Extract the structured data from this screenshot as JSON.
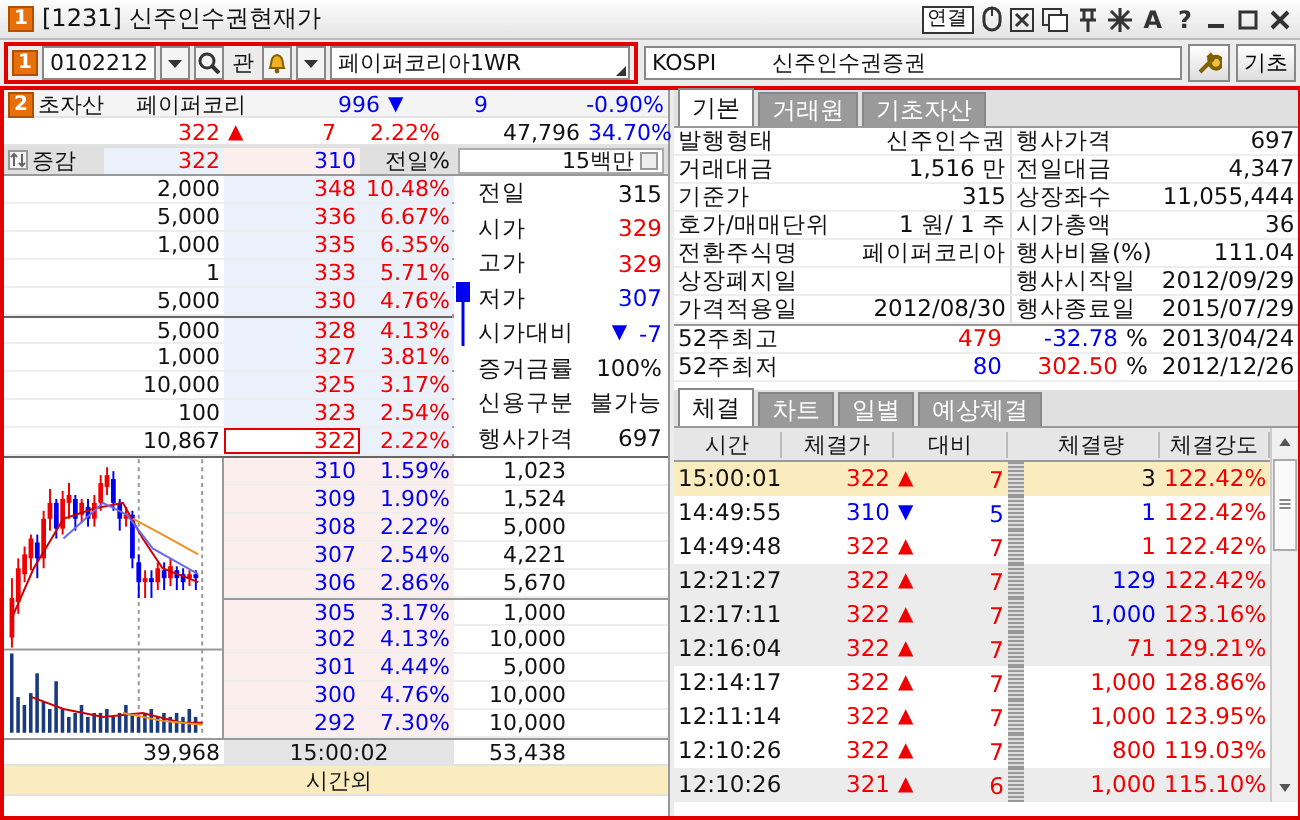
{
  "window": {
    "icon_label": "1",
    "title": "[1231] 신주인수권현재가",
    "link_button": "연결",
    "glyph_buttons": [
      "A",
      "?"
    ]
  },
  "toolbar": {
    "badge": "1",
    "code": "0102212",
    "mode": "관",
    "name": "페이퍼코리아1WR",
    "market": "KOSPI",
    "security_name": "신주인수권증권",
    "button": "기초"
  },
  "main": {
    "badge": "2"
  },
  "underlying": {
    "label": "초자산",
    "name": "페이퍼코리",
    "price": "996",
    "arrow": "▼",
    "color": "#0000f0",
    "change": "9",
    "rate": "-0.90%"
  },
  "current": {
    "price": "322",
    "arrow": "▲",
    "color": "#f00000",
    "change": "7",
    "rate": "2.22%",
    "volume": "47,796",
    "ratio": "34.70%"
  },
  "orderbook_header": {
    "label": "증감",
    "high": "322",
    "low": "310",
    "column": "전일%",
    "amount": "15백만"
  },
  "asks": [
    {
      "qty": "2,000",
      "price": "348",
      "pct": "10.48%",
      "current": false
    },
    {
      "qty": "5,000",
      "price": "336",
      "pct": "6.67%",
      "current": false
    },
    {
      "qty": "1,000",
      "price": "335",
      "pct": "6.35%",
      "current": false
    },
    {
      "qty": "1",
      "price": "333",
      "pct": "5.71%",
      "current": false
    },
    {
      "qty": "5,000",
      "price": "330",
      "pct": "4.76%",
      "current": false
    },
    {
      "qty": "5,000",
      "price": "328",
      "pct": "4.13%",
      "current": false
    },
    {
      "qty": "1,000",
      "price": "327",
      "pct": "3.81%",
      "current": false
    },
    {
      "qty": "10,000",
      "price": "325",
      "pct": "3.17%",
      "current": false
    },
    {
      "qty": "100",
      "price": "323",
      "pct": "2.54%",
      "current": false
    },
    {
      "qty": "10,867",
      "price": "322",
      "pct": "2.22%",
      "current": true
    }
  ],
  "info": [
    {
      "label": "전일",
      "value": "315",
      "color": "#111111"
    },
    {
      "label": "시가",
      "value": "329",
      "color": "#f00000"
    },
    {
      "label": "고가",
      "value": "329",
      "color": "#f00000"
    },
    {
      "label": "저가",
      "value": "307",
      "color": "#0000f0"
    },
    {
      "label": "시가대비",
      "value": "-7",
      "color": "#0000f0",
      "arrow": "▼"
    },
    {
      "label": "증거금률",
      "value": "100%",
      "color": "#111111"
    },
    {
      "label": "신용구분",
      "value": "불가능",
      "color": "#111111"
    },
    {
      "label": "행사가격",
      "value": "697",
      "color": "#111111"
    }
  ],
  "bids": [
    {
      "price": "310",
      "pct": "1.59%",
      "qty": "1,023"
    },
    {
      "price": "309",
      "pct": "1.90%",
      "qty": "1,524"
    },
    {
      "price": "308",
      "pct": "2.22%",
      "qty": "5,000"
    },
    {
      "price": "307",
      "pct": "2.54%",
      "qty": "4,221"
    },
    {
      "price": "306",
      "pct": "2.86%",
      "qty": "5,670"
    },
    {
      "price": "305",
      "pct": "3.17%",
      "qty": "1,000"
    },
    {
      "price": "302",
      "pct": "4.13%",
      "qty": "10,000"
    },
    {
      "price": "301",
      "pct": "4.44%",
      "qty": "5,000"
    },
    {
      "price": "300",
      "pct": "4.76%",
      "qty": "10,000"
    },
    {
      "price": "292",
      "pct": "7.30%",
      "qty": "10,000"
    }
  ],
  "totals": {
    "ask_total": "39,968",
    "time": "15:00:02",
    "bid_total": "53,438"
  },
  "session": "시간외",
  "tabs": [
    {
      "label": "기본",
      "selected": true
    },
    {
      "label": "거래원",
      "selected": false
    },
    {
      "label": "기초자산",
      "selected": false
    }
  ],
  "basic_info": [
    {
      "label": "발행형태",
      "value": "신주인수권",
      "label_2": "행사가격",
      "value_2": "697"
    },
    {
      "label": "거래대금",
      "value": "1,516 만",
      "label_2": "전일대금",
      "value_2": "4,347"
    },
    {
      "label": "기준가",
      "value": "315",
      "label_2": "상장좌수",
      "value_2": "11,055,444"
    },
    {
      "label": "호가/매매단위",
      "value": "1 원/ 1 주",
      "label_2": "시가총액",
      "value_2": "36"
    },
    {
      "label": "전환주식명",
      "value": "페이퍼코리아",
      "label_2": "행사비율(%)",
      "value_2": "111.04"
    },
    {
      "label": "상장폐지일",
      "label_2": "행사시작일",
      "value_2": "2012/09/29"
    },
    {
      "label": "가격적용일",
      "value": "2012/08/30",
      "label_2": "행사종료일",
      "value_2": "2015/07/29"
    }
  ],
  "week52": [
    {
      "label": "52주최고",
      "price": {
        "value": "479",
        "color": "#f00000"
      },
      "rate": {
        "value": "-32.78",
        "color": "#0000f0"
      },
      "unit": "%",
      "date": "2013/04/24"
    },
    {
      "label": "52주최저",
      "price": {
        "value": "80",
        "color": "#0000f0"
      },
      "rate": {
        "value": "302.50",
        "color": "#f00000"
      },
      "unit": "%",
      "date": "2012/12/26"
    }
  ],
  "trade_tabs": [
    {
      "label": "체결",
      "selected": true
    },
    {
      "label": "차트",
      "selected": false
    },
    {
      "label": "일별",
      "selected": false
    },
    {
      "label": "예상체결",
      "selected": false
    }
  ],
  "trade_columns": [
    "시간",
    "체결가",
    "대비",
    "체결량",
    "체결강도"
  ],
  "trades": [
    {
      "time": "15:00:01",
      "price": "322",
      "color": "#f00000",
      "arrow": "▲",
      "change": "7",
      "volume": {
        "value": "3",
        "color": "#111111"
      },
      "strength": "122.42%",
      "selected": true
    },
    {
      "time": "14:49:55",
      "price": "310",
      "color": "#0000f0",
      "arrow": "▼",
      "change": "5",
      "volume": {
        "value": "1",
        "color": "#0000f0"
      },
      "strength": "122.42%",
      "selected": false
    },
    {
      "time": "14:49:48",
      "price": "322",
      "color": "#f00000",
      "arrow": "▲",
      "change": "7",
      "volume": {
        "value": "1",
        "color": "#f00000"
      },
      "strength": "122.42%",
      "selected": false
    },
    {
      "time": "12:21:27",
      "price": "322",
      "color": "#f00000",
      "arrow": "▲",
      "change": "7",
      "volume": {
        "value": "129",
        "color": "#0000f0"
      },
      "strength": "122.42%",
      "selected": false
    },
    {
      "time": "12:17:11",
      "price": "322",
      "color": "#f00000",
      "arrow": "▲",
      "change": "7",
      "volume": {
        "value": "1,000",
        "color": "#0000f0"
      },
      "strength": "123.16%",
      "selected": false
    },
    {
      "time": "12:16:04",
      "price": "322",
      "color": "#f00000",
      "arrow": "▲",
      "change": "7",
      "volume": {
        "value": "71",
        "color": "#f00000"
      },
      "strength": "129.21%",
      "selected": false
    },
    {
      "time": "12:14:17",
      "price": "322",
      "color": "#f00000",
      "arrow": "▲",
      "change": "7",
      "volume": {
        "value": "1,000",
        "color": "#f00000"
      },
      "strength": "128.86%",
      "selected": false
    },
    {
      "time": "12:11:14",
      "price": "322",
      "color": "#f00000",
      "arrow": "▲",
      "change": "7",
      "volume": {
        "value": "1,000",
        "color": "#f00000"
      },
      "strength": "123.95%",
      "selected": false
    },
    {
      "time": "12:10:26",
      "price": "322",
      "color": "#f00000",
      "arrow": "▲",
      "change": "7",
      "volume": {
        "value": "800",
        "color": "#f00000"
      },
      "strength": "119.03%",
      "selected": false
    },
    {
      "time": "12:10:26",
      "price": "321",
      "color": "#f00000",
      "arrow": "▲",
      "change": "6",
      "volume": {
        "value": "1,000",
        "color": "#f00000"
      },
      "strength": "115.10%",
      "selected": false
    }
  ]
}
